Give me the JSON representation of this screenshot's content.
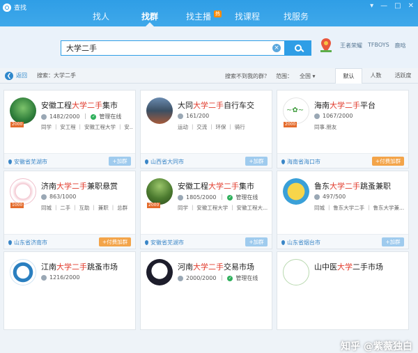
{
  "app": {
    "title": "查找"
  },
  "window": {
    "min": "—",
    "max": "□",
    "close": "✕",
    "skin": "▾"
  },
  "nav": {
    "tabs": [
      "找人",
      "找群",
      "找主播",
      "找课程",
      "找服务"
    ],
    "hot_badge": "热"
  },
  "search": {
    "value": "大学二手",
    "clear": "×"
  },
  "hotwords": [
    "王者荣耀",
    "TFBOYS",
    "鹿晗"
  ],
  "filter": {
    "back": "返回",
    "search_label": "搜索：大学二手",
    "not_found": "搜索不到我的群？",
    "scope_label": "范围：",
    "scope_value": "全国",
    "sorts": [
      "默认",
      "人数",
      "活跃度"
    ]
  },
  "cards": [
    {
      "pre": "安徽工程",
      "hl": "大学二手",
      "post": "集市",
      "members": "1482/2000",
      "admin": "管理在线",
      "tags": "同学 ｜ 安工程 ｜ 安徽工程大学 ｜ 安...",
      "loc": "安徽省芜湖市",
      "join": "+加群",
      "level": "2000",
      "paid": false
    },
    {
      "pre": "大同",
      "hl": "大学二手",
      "post": "自行车交",
      "members": "161/200",
      "admin": "",
      "tags": "运动 ｜ 交流 ｜ 环保 ｜ 骑行",
      "loc": "山西省大同市",
      "join": "+加群",
      "level": "",
      "paid": false
    },
    {
      "pre": "海南",
      "hl": "大学二手",
      "post": "平台",
      "members": "1067/2000",
      "admin": "",
      "tags": "同事.朋友",
      "loc": "海南省海口市",
      "join": "+付费加群",
      "level": "2000",
      "paid": true
    },
    {
      "pre": "济南",
      "hl": "大学二手",
      "post": "兼职悬赏",
      "members": "863/1000",
      "admin": "",
      "tags": "同城 ｜ 二手 ｜ 互助 ｜ 兼职 ｜ 总群",
      "loc": "山东省济南市",
      "join": "+付费加群",
      "level": "1000",
      "paid": true
    },
    {
      "pre": "安徽工程",
      "hl": "大学二手",
      "post": "集市",
      "members": "1805/2000",
      "admin": "管理在线",
      "tags": "同学 ｜ 安徽工程大学 ｜ 安徽工程大...",
      "loc": "安徽省芜湖市",
      "join": "+加群",
      "level": "2000",
      "paid": false
    },
    {
      "pre": "鲁东",
      "hl": "大学二手",
      "post": "跳蚤兼职",
      "members": "497/500",
      "admin": "",
      "tags": "同城 ｜ 鲁东大学二手 ｜ 鲁东大学兼...",
      "loc": "山东省烟台市",
      "join": "+加群",
      "level": "",
      "paid": false
    },
    {
      "pre": "江南",
      "hl": "大学二手",
      "post": "跳蚤市场",
      "members": "1216/2000",
      "admin": "",
      "tags": "",
      "loc": "",
      "join": "",
      "level": "",
      "paid": false
    },
    {
      "pre": "河南",
      "hl": "大学二手",
      "post": "交易市场",
      "members": "2000/2000",
      "admin": "管理在线",
      "tags": "",
      "loc": "",
      "join": "",
      "level": "",
      "paid": false
    },
    {
      "pre": "山中医",
      "hl": "大学",
      "post": "二手市场",
      "members": "",
      "admin": "",
      "tags": "",
      "loc": "",
      "join": "",
      "level": "",
      "paid": false
    }
  ],
  "watermark": "知乎 @紫薇独白",
  "colors": {
    "accent": "#2f9ee6",
    "highlight": "#e13b2c",
    "paid": "#f3a449"
  }
}
